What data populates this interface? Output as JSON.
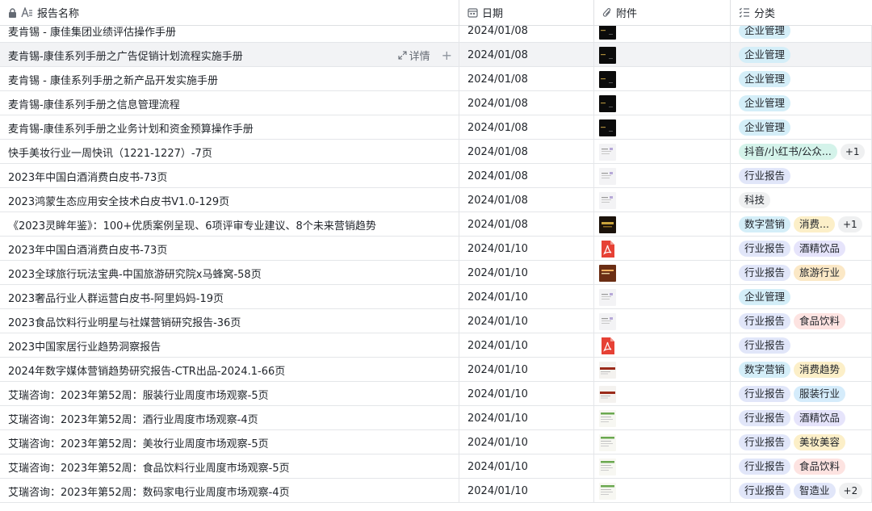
{
  "header": {
    "name_label": "报告名称",
    "date_label": "日期",
    "attach_label": "附件",
    "cat_label": "分类"
  },
  "hover": {
    "detail_label": "详情",
    "plus_label": "+"
  },
  "colors": {
    "企业管理": "#d4eef8",
    "抖音/小红书/公众...": "#d4f3ea",
    "行业报告": "#e1e6f9",
    "科技": "#eff0f1",
    "数字营销": "#d4eef8",
    "消费...": "#fcefc8",
    "酒精饮品": "#e6e4fb",
    "旅游行业": "#fbe8c6",
    "食品饮料": "#fde3e1",
    "消费趋势": "#fcefc8",
    "服装行业": "#d5ecfb",
    "美妆美容": "#fcefc8",
    "智造业": "#e1e6f9"
  },
  "rows": [
    {
      "name": "麦肯锡 - 康佳集团业绩评估操作手册",
      "date": "2024/01/08",
      "thumb": "dark",
      "tags": [
        "企业管理"
      ],
      "more": ""
    },
    {
      "name": "麦肯锡-康佳系列手册之广告促销计划流程实施手册",
      "date": "2024/01/08",
      "thumb": "dark",
      "tags": [
        "企业管理"
      ],
      "more": ""
    },
    {
      "name": "麦肯锡 - 康佳系列手册之新产品开发实施手册",
      "date": "2024/01/08",
      "thumb": "dark",
      "tags": [
        "企业管理"
      ],
      "more": ""
    },
    {
      "name": "麦肯锡-康佳系列手册之信息管理流程",
      "date": "2024/01/08",
      "thumb": "dark",
      "tags": [
        "企业管理"
      ],
      "more": ""
    },
    {
      "name": "麦肯锡-康佳系列手册之业务计划和资金预算操作手册",
      "date": "2024/01/08",
      "thumb": "dark",
      "tags": [
        "企业管理"
      ],
      "more": ""
    },
    {
      "name": "快手美妆行业一周快讯（1221-1227）-7页",
      "date": "2024/01/08",
      "thumb": "light",
      "tags": [
        "抖音/小红书/公众..."
      ],
      "more": "+1"
    },
    {
      "name": "2023年中国白酒消费白皮书-73页",
      "date": "2024/01/08",
      "thumb": "light",
      "tags": [
        "行业报告"
      ],
      "more": ""
    },
    {
      "name": "2023鸿蒙生态应用安全技术白皮书V1.0-129页",
      "date": "2024/01/08",
      "thumb": "light",
      "tags": [
        "科技"
      ],
      "more": ""
    },
    {
      "name": "《2023灵眸年鉴》：100+优质案例呈现、6项评审专业建议、8个未来营销趋势",
      "date": "2024/01/08",
      "thumb": "gold",
      "tags": [
        "数字营销",
        "消费..."
      ],
      "more": "+1"
    },
    {
      "name": "2023年中国白酒消费白皮书-73页",
      "date": "2024/01/10",
      "thumb": "pdf",
      "tags": [
        "行业报告",
        "酒精饮品"
      ],
      "more": ""
    },
    {
      "name": "2023全球旅行玩法宝典-中国旅游研究院x马蜂窝-58页",
      "date": "2024/01/10",
      "thumb": "brown",
      "tags": [
        "行业报告",
        "旅游行业"
      ],
      "more": ""
    },
    {
      "name": "2023奢品行业人群运营白皮书-阿里妈妈-19页",
      "date": "2024/01/10",
      "thumb": "light",
      "tags": [
        "企业管理"
      ],
      "more": ""
    },
    {
      "name": "2023食品饮料行业明星与社媒营销研究报告-36页",
      "date": "2024/01/10",
      "thumb": "light",
      "tags": [
        "行业报告",
        "食品饮料"
      ],
      "more": ""
    },
    {
      "name": "2023中国家居行业趋势洞察报告",
      "date": "2024/01/10",
      "thumb": "pdf",
      "tags": [
        "行业报告"
      ],
      "more": ""
    },
    {
      "name": "2024年数字媒体营销趋势研究报告-CTR出品-2024.1-66页",
      "date": "2024/01/10",
      "thumb": "redbar",
      "tags": [
        "数字营销",
        "消费趋势"
      ],
      "more": ""
    },
    {
      "name": "艾瑞咨询：2023年第52周：服装行业周度市场观察-5页",
      "date": "2024/01/10",
      "thumb": "redbar",
      "tags": [
        "行业报告",
        "服装行业"
      ],
      "more": ""
    },
    {
      "name": "艾瑞咨询：2023年第52周：酒行业周度市场观察-4页",
      "date": "2024/01/10",
      "thumb": "green",
      "tags": [
        "行业报告",
        "酒精饮品"
      ],
      "more": ""
    },
    {
      "name": "艾瑞咨询：2023年第52周：美妆行业周度市场观察-5页",
      "date": "2024/01/10",
      "thumb": "green",
      "tags": [
        "行业报告",
        "美妆美容"
      ],
      "more": ""
    },
    {
      "name": "艾瑞咨询：2023年第52周：食品饮料行业周度市场观察-5页",
      "date": "2024/01/10",
      "thumb": "green",
      "tags": [
        "行业报告",
        "食品饮料"
      ],
      "more": ""
    },
    {
      "name": "艾瑞咨询：2023年第52周：数码家电行业周度市场观察-4页",
      "date": "2024/01/10",
      "thumb": "green",
      "tags": [
        "行业报告",
        "智造业"
      ],
      "more": "+2"
    }
  ]
}
